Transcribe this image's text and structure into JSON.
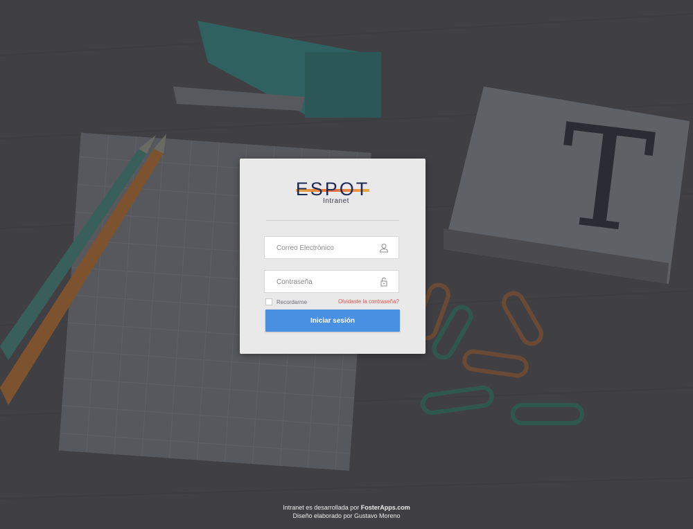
{
  "colors": {
    "accent": "#4a90e2",
    "link_warning": "#e8534a",
    "brand_navy": "#1f2a55",
    "brand_orange": "#e8a32c"
  },
  "login": {
    "logo_text": "ESPOT",
    "logo_subtitle": "Intranet",
    "email_placeholder": "Correo Electrónico",
    "email_icon": "user-icon",
    "password_placeholder": "Contraseña",
    "password_icon": "unlock-icon",
    "remember_label": "Recordarme",
    "forgot_link": "Olvidaste la contraseña?",
    "submit_label": "Iniciar sesión"
  },
  "footer": {
    "line1_prefix": "Intranet es desarrollada por ",
    "line1_brand": "FosterApps.com",
    "line2": "Diseño elaborado por Gustavo Moreno"
  }
}
